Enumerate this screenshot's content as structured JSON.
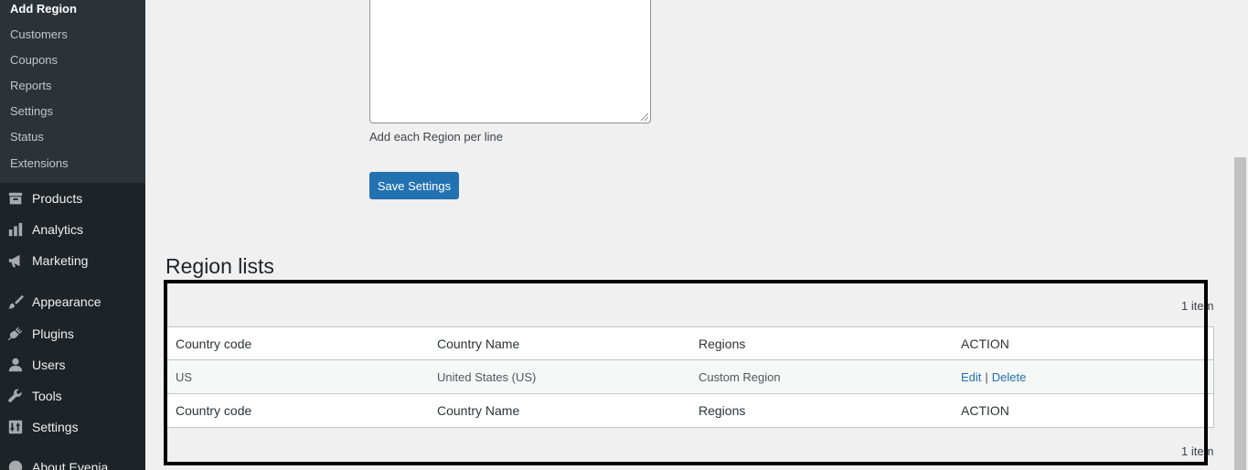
{
  "sidebar": {
    "submenu": [
      {
        "label": "Add Region",
        "current": true
      },
      {
        "label": "Customers"
      },
      {
        "label": "Coupons"
      },
      {
        "label": "Reports"
      },
      {
        "label": "Settings"
      },
      {
        "label": "Status"
      },
      {
        "label": "Extensions"
      }
    ],
    "menu": [
      {
        "label": "Products",
        "icon": "archive-icon"
      },
      {
        "label": "Analytics",
        "icon": "bar-chart-icon"
      },
      {
        "label": "Marketing",
        "icon": "megaphone-icon"
      },
      {
        "label": "Appearance",
        "icon": "paintbrush-icon"
      },
      {
        "label": "Plugins",
        "icon": "plug-icon"
      },
      {
        "label": "Users",
        "icon": "user-icon"
      },
      {
        "label": "Tools",
        "icon": "wrench-icon"
      },
      {
        "label": "Settings",
        "icon": "sliders-icon"
      },
      {
        "label": "About Evenia",
        "icon": "info-icon"
      }
    ]
  },
  "form": {
    "help_text": "Add each Region per line",
    "save_label": "Save Settings"
  },
  "region_list": {
    "title": "Region lists",
    "items_count": "1 item",
    "columns": [
      "Country code",
      "Country Name",
      "Regions",
      "ACTION"
    ],
    "rows": [
      {
        "code": "US",
        "name": "United States (US)",
        "regions": "Custom Region",
        "edit": "Edit",
        "separator": "|",
        "delete": "Delete"
      }
    ]
  },
  "colors": {
    "sidebar_bg": "#1d2327",
    "submenu_bg": "#2c3338",
    "accent": "#2271b1",
    "page_bg": "#f0f0f1"
  }
}
